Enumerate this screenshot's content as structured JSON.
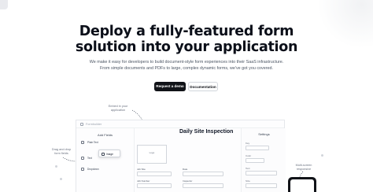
{
  "hero": {
    "title_line1": "Deploy a fully-featured form",
    "title_line2": "solution into your application",
    "subtitle": "We make it easy for developers to build document-style form experiences into their SaaS infrastructure. From simple documents and PDFs to large, complex dynamic forms, we've got you covered."
  },
  "cta": {
    "primary_label": "Request a demo",
    "secondary_label": "Documentation"
  },
  "annotations": {
    "embed": "Embed in your application",
    "drag": "Drag and drop form fields",
    "multi": "Multi-screen responsive"
  },
  "app": {
    "window_title": "Formbuilder",
    "left_panel_heading": "Add Fields",
    "fields": [
      "Plain Text",
      "Text",
      "Dropdown"
    ],
    "drag_card_label": "Image",
    "logo_placeholder": "Logo",
    "doc_title": "Daily Site Inspection",
    "labels": {
      "job_site": "Job Site",
      "date": "Date",
      "job_number": "Job Number",
      "inspector": "Inspector"
    },
    "right_panel_heading": "Settings",
    "right_labels": [
      "Key",
      "Color",
      "Text",
      "Size"
    ]
  },
  "colors": {
    "primary_button": "#111318",
    "page_bg": "#ffffff",
    "subtitle_text": "#4b5563"
  }
}
